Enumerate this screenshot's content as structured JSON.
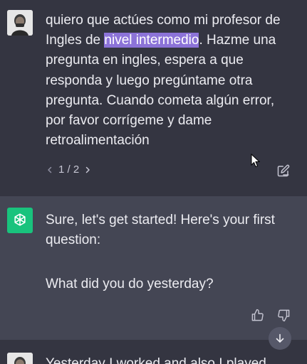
{
  "conversation": {
    "user_message": {
      "before_highlight": "quiero que actúes como mi profesor de Ingles de ",
      "highlight": "nivel intermedio",
      "after_highlight": ". Hazme una pregunta en ingles, espera a que responda y luego pregúntame otra pregunta. Cuando cometa algún error, por favor corrígeme y dame retroalimentación"
    },
    "pager": {
      "prev_icon": "chevron-left-icon",
      "label": "1 / 2",
      "next_icon": "chevron-right-icon"
    },
    "assistant_message": {
      "line1": "Sure, let's get started! Here's your first question:",
      "line2": "What did you do yesterday?"
    },
    "next_user_message_partial": "Yesterday I worked and also I played"
  },
  "colors": {
    "user_bg": "#343541",
    "assistant_bg": "#444654",
    "text": "#ececf1",
    "highlight": "#8c73d8",
    "openai_green": "#19c37d"
  },
  "icons": [
    "edit-icon",
    "thumbs-up-icon",
    "thumbs-down-icon",
    "arrow-down-icon",
    "openai-logo-icon"
  ]
}
